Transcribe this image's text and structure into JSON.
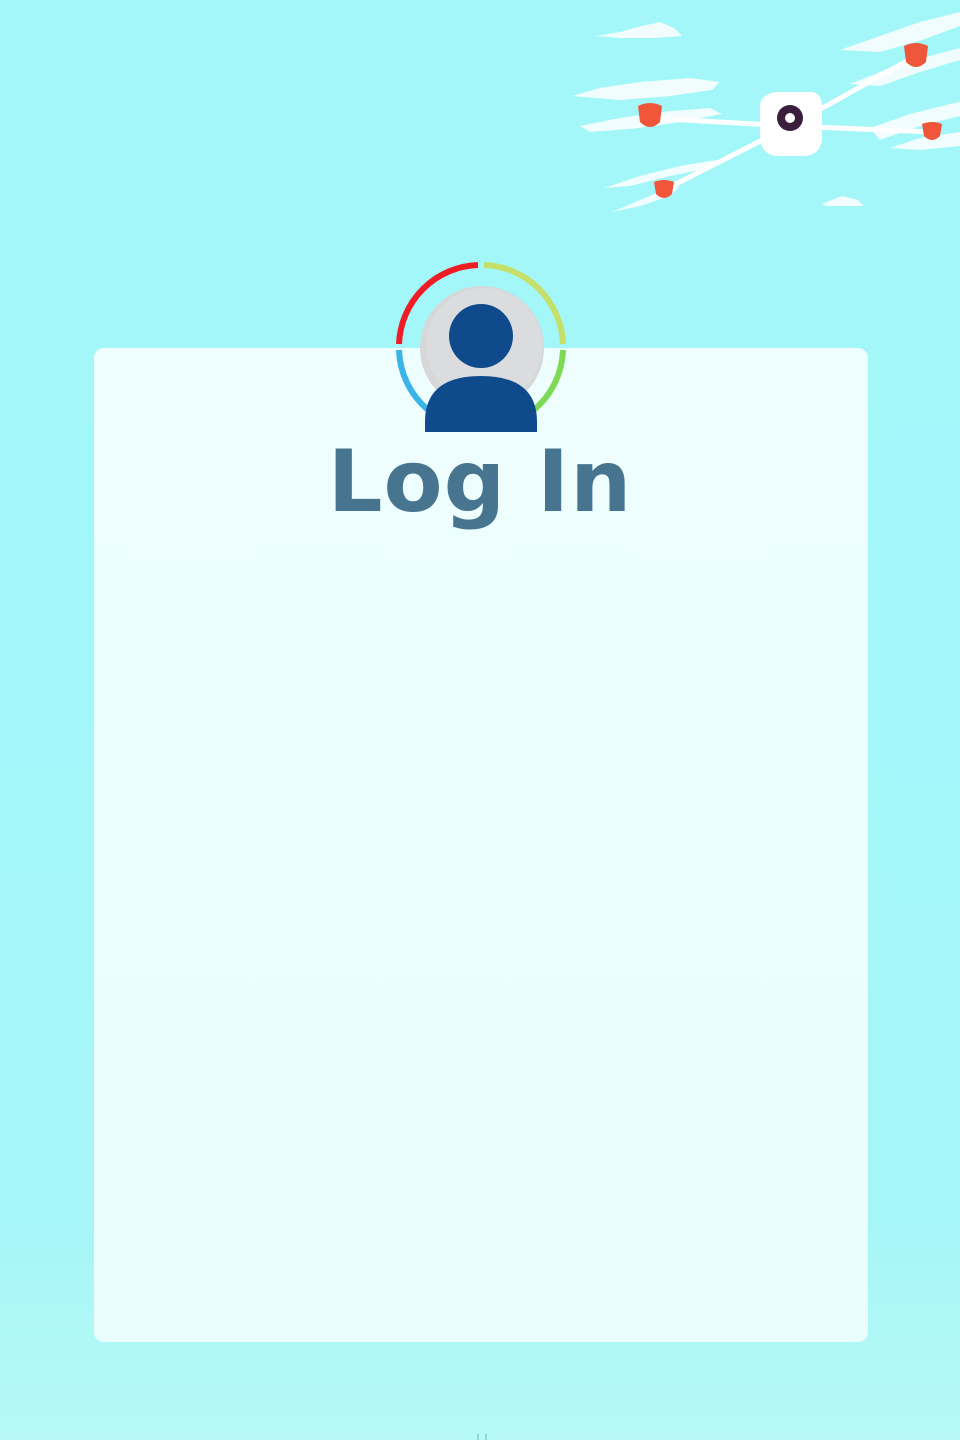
{
  "login": {
    "title": "Log In"
  },
  "icons": {
    "avatar": "user-avatar-icon",
    "drone": "drone-illustration",
    "clouds": "cloud-illustration"
  },
  "colors": {
    "background": "#a4f7f8",
    "card": "#f0feff",
    "title": "#477590",
    "avatar_body": "#0f4b8c",
    "ring_red": "#ee1c25",
    "ring_yellow_green": "#c5e06a",
    "ring_green": "#7ed957",
    "ring_blue": "#3ab3e8",
    "propeller_red": "#f0563a"
  }
}
